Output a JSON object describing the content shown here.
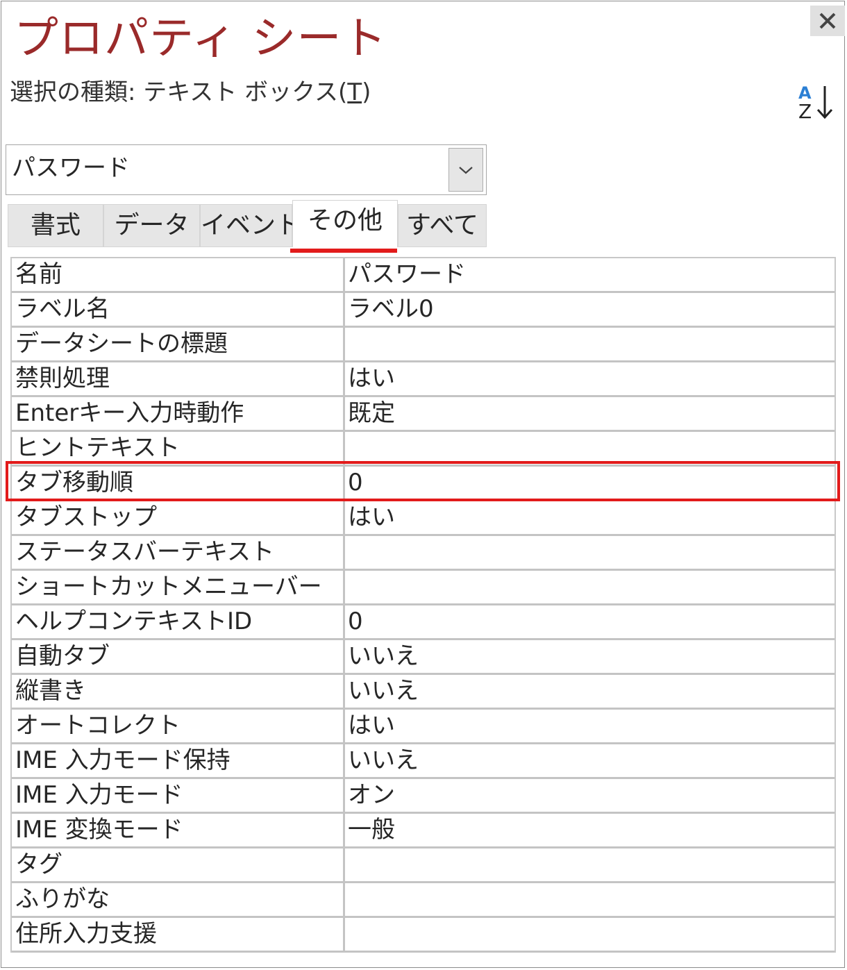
{
  "window": {
    "title": "プロパティ シート",
    "close_icon": "close-icon"
  },
  "selection": {
    "label": "選択の種類:",
    "type_prefix": " テキスト ボックス(",
    "type_underlined": "T",
    "type_suffix": ")",
    "sort_icon": "sort-az-icon"
  },
  "object_combo": {
    "value": "パスワード",
    "dropdown_icon": "chevron-down-icon"
  },
  "tabs": [
    {
      "label": "書式",
      "active": false
    },
    {
      "label": "データ",
      "active": false
    },
    {
      "label": "イベント",
      "active": false
    },
    {
      "label": "その他",
      "active": true
    },
    {
      "label": "すべて",
      "active": false
    }
  ],
  "properties": [
    {
      "name": "名前",
      "value": "パスワード"
    },
    {
      "name": "ラベル名",
      "value": "ラベル0"
    },
    {
      "name": "データシートの標題",
      "value": ""
    },
    {
      "name": "禁則処理",
      "value": "はい"
    },
    {
      "name": "Enterキー入力時動作",
      "value": "既定"
    },
    {
      "name": "ヒントテキスト",
      "value": ""
    },
    {
      "name": "タブ移動順",
      "value": "0"
    },
    {
      "name": "タブストップ",
      "value": "はい"
    },
    {
      "name": "ステータスバーテキスト",
      "value": ""
    },
    {
      "name": "ショートカットメニューバー",
      "value": ""
    },
    {
      "name": "ヘルプコンテキストID",
      "value": "0"
    },
    {
      "name": "自動タブ",
      "value": "いいえ"
    },
    {
      "name": "縦書き",
      "value": "いいえ"
    },
    {
      "name": "オートコレクト",
      "value": "はい"
    },
    {
      "name": "IME 入力モード保持",
      "value": "いいえ"
    },
    {
      "name": "IME 入力モード",
      "value": "オン"
    },
    {
      "name": "IME 変換モード",
      "value": "一般"
    },
    {
      "name": "タグ",
      "value": ""
    },
    {
      "name": "ふりがな",
      "value": ""
    },
    {
      "name": "住所入力支援",
      "value": ""
    }
  ],
  "colors": {
    "title": "#9a2a2a",
    "highlight": "#e21b1b",
    "sort_letter_a": "#2b7fd4"
  }
}
